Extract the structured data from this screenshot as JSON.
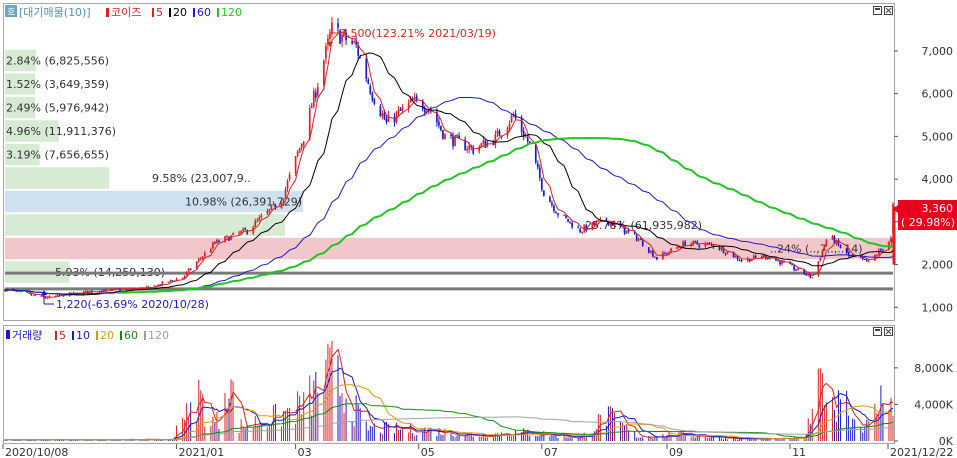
{
  "price_panel": {
    "legend": {
      "badge": "호",
      "prefix": "[대기매물(10)]",
      "name": "코이즈",
      "mas": [
        {
          "label": "5",
          "color": "#e0201e"
        },
        {
          "label": "20",
          "color": "#000000"
        },
        {
          "label": "60",
          "color": "#1a1ad0"
        },
        {
          "label": "120",
          "color": "#22c422"
        }
      ]
    },
    "last_price_box": {
      "price": "3,360",
      "change": "( 29.98%)"
    },
    "high_note": "7,500(123.21% 2021/03/19)",
    "low_note": "1,220(-63.69% 2020/10/28)"
  },
  "volume_panel": {
    "legend": {
      "name": "거래량",
      "mas": [
        {
          "label": "5",
          "color": "#e0201e"
        },
        {
          "label": "10",
          "color": "#1a1ad0"
        },
        {
          "label": "20",
          "color": "#e09a10"
        },
        {
          "label": "60",
          "color": "#148a14"
        },
        {
          "label": "120",
          "color": "#a0a0a0"
        }
      ]
    }
  },
  "x_axis": {
    "tick_labels": [
      "2020/10/08",
      "2021/01",
      "03",
      "05",
      "07",
      "09",
      "11",
      "2021/12/22"
    ]
  },
  "chart_data": [
    {
      "type": "candlestick",
      "title": "코이즈",
      "y_axis": {
        "ticks": [
          1000,
          2000,
          3000,
          4000,
          5000,
          6000,
          7000
        ],
        "tick_labels": [
          "1,000",
          "2,000",
          "3,000",
          "4,000",
          "5,000",
          "6,000",
          "7,000"
        ],
        "ylim": [
          750,
          8050
        ]
      },
      "series": [
        {
          "name": "5",
          "color": "#e0201e"
        },
        {
          "name": "20",
          "color": "#000000"
        },
        {
          "name": "60",
          "color": "#1a1ad0"
        },
        {
          "name": "120",
          "color": "#22c422"
        }
      ],
      "price_path": [
        [
          "2020/10/08",
          1420
        ],
        [
          "2020/10/28",
          1220
        ],
        [
          "2020/11/20",
          1380
        ],
        [
          "2020/12/18",
          1450
        ],
        [
          "2021/01/04",
          1700
        ],
        [
          "2021/01/20",
          2500
        ],
        [
          "2021/02/05",
          2800
        ],
        [
          "2021/02/22",
          3500
        ],
        [
          "2021/03/05",
          5000
        ],
        [
          "2021/03/19",
          7500
        ],
        [
          "2021/03/31",
          7100
        ],
        [
          "2021/04/08",
          6000
        ],
        [
          "2021/04/15",
          5300
        ],
        [
          "2021/04/28",
          5800
        ],
        [
          "2021/05/06",
          5700
        ],
        [
          "2021/05/14",
          5000
        ],
        [
          "2021/05/28",
          4700
        ],
        [
          "2021/06/08",
          4950
        ],
        [
          "2021/06/17",
          5500
        ],
        [
          "2021/06/25",
          4800
        ],
        [
          "2021/07/02",
          3700
        ],
        [
          "2021/07/09",
          3200
        ],
        [
          "2021/07/20",
          2800
        ],
        [
          "2021/08/02",
          3050
        ],
        [
          "2021/08/18",
          2600
        ],
        [
          "2021/08/27",
          2150
        ],
        [
          "2021/09/10",
          2500
        ],
        [
          "2021/09/25",
          2450
        ],
        [
          "2021/10/08",
          2100
        ],
        [
          "2021/10/20",
          2200
        ],
        [
          "2021/10/30",
          2000
        ],
        [
          "2021/11/12",
          1700
        ],
        [
          "2021/11/20",
          2700
        ],
        [
          "2021/11/30",
          2200
        ],
        [
          "2021/12/10",
          2050
        ],
        [
          "2021/12/21",
          2600
        ],
        [
          "2021/12/22",
          3360
        ]
      ],
      "volume_profile": [
        {
          "label": "2.84% (6,825,556)",
          "price_low": 6500,
          "price_high": 7050,
          "pct": 2.84
        },
        {
          "label": "1.52% (3,649,359)",
          "price_low": 5950,
          "price_high": 6500,
          "pct": 1.52
        },
        {
          "label": "2.49% (5,976,942)",
          "price_low": 5400,
          "price_high": 5950,
          "pct": 2.49
        },
        {
          "label": "4.96% (11,911,376)",
          "price_low": 4850,
          "price_high": 5400,
          "pct": 4.96
        },
        {
          "label": "3.19% (7,656,655)",
          "price_low": 4300,
          "price_high": 4850,
          "pct": 3.19
        },
        {
          "label": "9.58% (23,007,9..",
          "price_low": 3750,
          "price_high": 4300,
          "pct": 9.58
        },
        {
          "label": "10.98% (26,391,729)",
          "price_low": 3200,
          "price_high": 3750,
          "pct": 10.98,
          "highlight": "blue"
        },
        {
          "label": "25.78% (61,935,982)",
          "price_low": 2650,
          "price_high": 3200,
          "pct": 25.78
        },
        {
          "label": "..24% (..,7..,..14)",
          "price_low": 2100,
          "price_high": 2650,
          "pct": 24,
          "highlight": "pink"
        },
        {
          "label": "5.93% (14,259,130)",
          "price_low": 1550,
          "price_high": 2100,
          "pct": 5.93
        }
      ],
      "reference_lines": [
        1800,
        1430
      ],
      "last_price": 3360,
      "last_change_pct": 29.98
    },
    {
      "type": "bar",
      "title": "거래량",
      "y_axis": {
        "ticks": [
          0,
          4000000,
          8000000
        ],
        "tick_labels": [
          "0K",
          "4,000K",
          "8,000K"
        ],
        "ylim": [
          0,
          10500000
        ]
      },
      "series": [
        {
          "name": "5",
          "color": "#e0201e"
        },
        {
          "name": "10",
          "color": "#1a1ad0"
        },
        {
          "name": "20",
          "color": "#e09a10"
        },
        {
          "name": "60",
          "color": "#148a14"
        },
        {
          "name": "120",
          "color": "#a0a0a0"
        }
      ],
      "volume_path": [
        [
          "2020/10/08",
          150000
        ],
        [
          "2020/12/30",
          200000
        ],
        [
          "2021/01/04",
          4500000
        ],
        [
          "2021/01/07",
          3000000
        ],
        [
          "2021/01/12",
          6500000
        ],
        [
          "2021/01/18",
          2500000
        ],
        [
          "2021/01/22",
          2800000
        ],
        [
          "2021/01/26",
          10000000
        ],
        [
          "2021/02/01",
          2000000
        ],
        [
          "2021/02/22",
          3500000
        ],
        [
          "2021/03/05",
          5000000
        ],
        [
          "2021/03/19",
          9500000
        ],
        [
          "2021/04/05",
          1800000
        ],
        [
          "2021/05/06",
          1500000
        ],
        [
          "2021/05/28",
          800000
        ],
        [
          "2021/06/21",
          1200000
        ],
        [
          "2021/07/06",
          900000
        ],
        [
          "2021/07/20",
          400000
        ],
        [
          "2021/08/02",
          3500000
        ],
        [
          "2021/08/18",
          600000
        ],
        [
          "2021/09/10",
          900000
        ],
        [
          "2021/10/08",
          300000
        ],
        [
          "2021/11/08",
          300000
        ],
        [
          "2021/11/18",
          9000000
        ],
        [
          "2021/11/22",
          4000000
        ],
        [
          "2021/11/26",
          8000000
        ],
        [
          "2021/12/02",
          3000000
        ],
        [
          "2021/12/10",
          2000000
        ],
        [
          "2021/12/21",
          8500000
        ],
        [
          "2021/12/22",
          3000000
        ]
      ]
    }
  ]
}
